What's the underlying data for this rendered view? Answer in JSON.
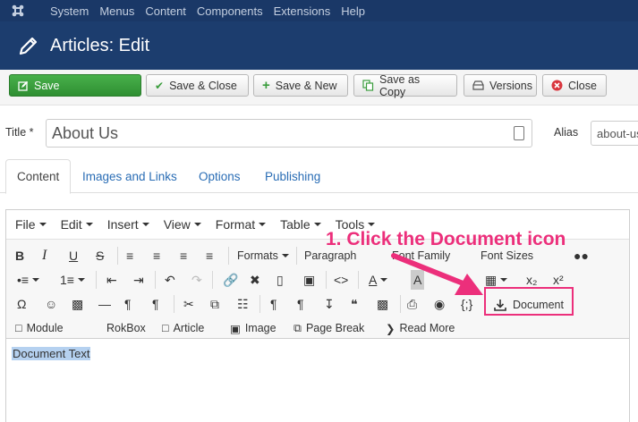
{
  "topnav": {
    "items": [
      "System",
      "Menus",
      "Content",
      "Components",
      "Extensions",
      "Help"
    ]
  },
  "header": {
    "title": "Articles: Edit"
  },
  "toolbar": {
    "save": "Save",
    "save_close": "Save & Close",
    "save_new": "Save & New",
    "save_copy": "Save as Copy",
    "versions": "Versions",
    "close": "Close"
  },
  "form": {
    "title_label": "Title *",
    "title_value": "About Us",
    "alias_label": "Alias",
    "alias_value": "about-us"
  },
  "tabs": [
    "Content",
    "Images and Links",
    "Options",
    "Publishing"
  ],
  "editor": {
    "menus": [
      "File",
      "Edit",
      "Insert",
      "View",
      "Format",
      "Table",
      "Tools"
    ],
    "formats": "Formats",
    "paragraph": "Paragraph",
    "font_family": "Font Family",
    "font_sizes": "Font Sizes",
    "document": "Document",
    "module": "Module",
    "rokbox": "RokBox",
    "article": "Article",
    "image": "Image",
    "page_break": "Page Break",
    "read_more": "Read More",
    "content_text": "Document Text"
  },
  "annotation": {
    "callout": "1. Click the Document icon",
    "color": "#ec2f7b"
  },
  "colors": {
    "topnav": "#1a3867",
    "header": "#1c3d6e",
    "save_green": "#3a9d3d",
    "tab_link": "#2a6db5"
  }
}
